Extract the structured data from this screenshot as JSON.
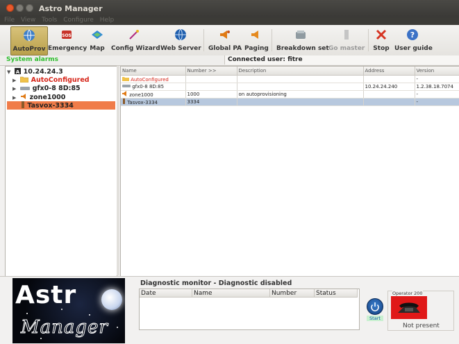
{
  "window": {
    "title": "Astro Manager"
  },
  "menu": [
    "File",
    "View",
    "Tools",
    "Configure",
    "Help"
  ],
  "toolbar": {
    "buttons": [
      {
        "label": "AutoProv",
        "icon": "globe-icon"
      },
      {
        "label": "Emergency",
        "icon": "sos-icon"
      },
      {
        "label": "Map",
        "icon": "map-icon"
      },
      {
        "label": "Config Wizard",
        "icon": "wand-icon"
      },
      {
        "label": "Web Server",
        "icon": "globe-icon"
      },
      {
        "label": "Global PA",
        "icon": "speaker-icon"
      },
      {
        "label": "Paging",
        "icon": "speaker-icon"
      },
      {
        "label": "Breakdown set",
        "icon": "phone-set-icon"
      },
      {
        "label": "Go master",
        "icon": "master-icon"
      },
      {
        "label": "Stop",
        "icon": "close-icon"
      },
      {
        "label": "User guide",
        "icon": "help-icon"
      }
    ]
  },
  "status": {
    "alarms": "System alarms",
    "connected": "Connected user: fitre"
  },
  "tree": {
    "root": "10.24.24.3",
    "items": [
      {
        "label": "AutoConfigured"
      },
      {
        "label": "gfx0-8 8D:85"
      },
      {
        "label": "zone1000"
      },
      {
        "label": "Tasvox-3334"
      }
    ]
  },
  "table": {
    "columns": [
      "Name",
      "Number >>",
      "Description",
      "Address",
      "Version"
    ],
    "rows": [
      {
        "name": "AutoConfigured",
        "number": "",
        "description": "",
        "address": "",
        "version": "-"
      },
      {
        "name": "gfx0-8 8D:85",
        "number": "",
        "description": "",
        "address": "10.24.24.240",
        "version": "1.2.38.18.7074"
      },
      {
        "name": "zone1000",
        "number": "1000",
        "description": "on autoprovisioning",
        "address": "",
        "version": "-"
      },
      {
        "name": "Tasvox-3334",
        "number": "3334",
        "description": "",
        "address": "",
        "version": "-"
      }
    ]
  },
  "logo": {
    "line1": "Astr",
    "line2": "Manager"
  },
  "diagnostic": {
    "title": "Diagnostic monitor - Diagnostic disabled",
    "columns": [
      "Date",
      "Name",
      "Number",
      "Status"
    ]
  },
  "start_button": {
    "label": "Start"
  },
  "operator": {
    "title": "Operator 200",
    "status": "Not present"
  }
}
